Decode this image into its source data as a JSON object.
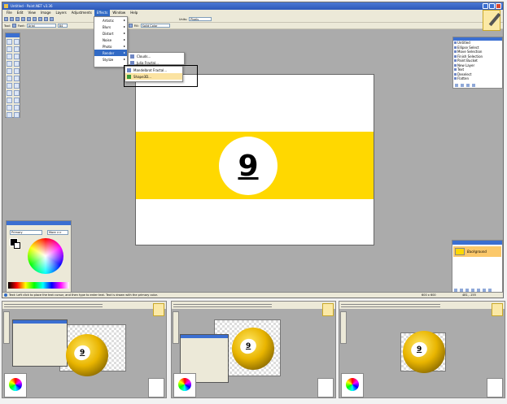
{
  "app": {
    "title": "Untitled - Paint.NET v3.36"
  },
  "menu": [
    "File",
    "Edit",
    "View",
    "Image",
    "Layers",
    "Adjustments",
    "Effects",
    "Window",
    "Help"
  ],
  "toolbar": {
    "units_label": "Units:",
    "units_value": "Pixels",
    "font_label": "Font:",
    "font_value": "Arial",
    "size_value": "84",
    "fill_label": "Fill:",
    "fill_value": "Solid Color",
    "tool_label": "Tool:"
  },
  "effects_menu": {
    "items": [
      "Artistic",
      "Blurs",
      "Distort",
      "Noise",
      "Photo",
      "Render",
      "Stylize"
    ],
    "highlighted": "Render"
  },
  "render_menu": {
    "items": [
      "Clouds...",
      "Julia Fractal...",
      "Mandelbrot Fractal...",
      "Shape3D..."
    ],
    "highlighted": "Shape3D..."
  },
  "canvas": {
    "ball_number": "9",
    "stripe_color": "#ffd800"
  },
  "history": {
    "items": [
      "Untitled",
      "Ellipse Select",
      "Move Selection",
      "Finish Selection",
      "Paint Bucket",
      "New Layer",
      "Text",
      "Deselect",
      "Flatten"
    ]
  },
  "colors": {
    "mode": "Primary",
    "more_label": "More >>"
  },
  "layers": {
    "items": [
      {
        "name": "Background"
      }
    ]
  },
  "status": {
    "text": "Text: Left click to place the text cursor, and then type to enter text. Text is drawn with the primary color.",
    "size": "600 x 600",
    "coords": "481, -155"
  },
  "thumbnails": [
    {
      "ball_number": "9"
    },
    {
      "ball_number": "9"
    },
    {
      "ball_number": "9"
    }
  ]
}
